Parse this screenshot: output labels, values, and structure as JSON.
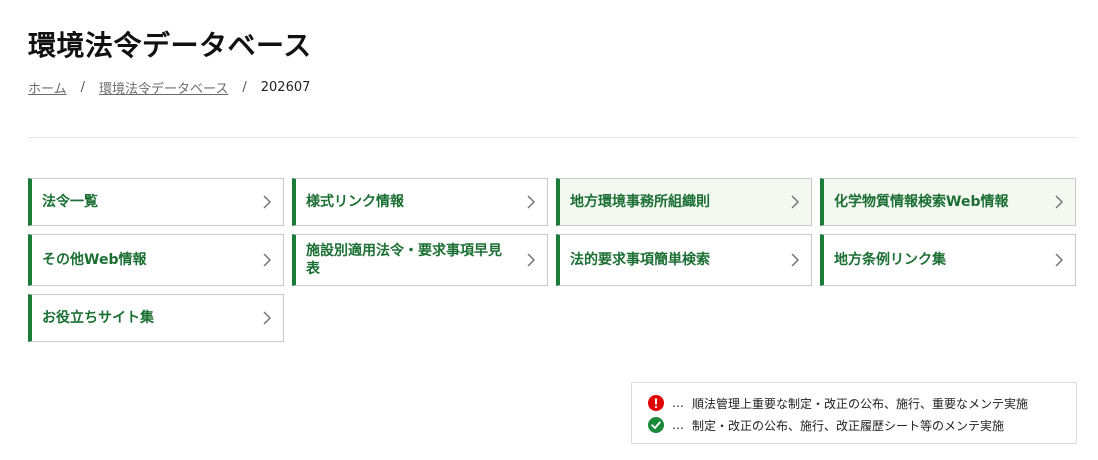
{
  "page": {
    "title": "環境法令データベース"
  },
  "breadcrumb": {
    "home": "ホーム",
    "section": "環境法令データベース",
    "current": "202607",
    "separator": "/"
  },
  "menu": {
    "accent_color": "#1b7d3a",
    "tiles": [
      {
        "label": "法令一覧"
      },
      {
        "label": "様式リンク情報"
      },
      {
        "label": "地方環境事務所組織則"
      },
      {
        "label": "化学物質情報検索Web情報"
      },
      {
        "label": "その他Web情報"
      },
      {
        "label": "施設別適用法令・要求事項早見表"
      },
      {
        "label": "法的要求事項簡単検索"
      },
      {
        "label": "地方条例リンク集"
      },
      {
        "label": "お役立ちサイト集"
      }
    ]
  },
  "legend": {
    "dots": "…",
    "important": {
      "icon": "exclamation-circle-icon",
      "color": "#e00000",
      "text": "順法管理上重要な制定・改正の公布、施行、重要なメンテ実施"
    },
    "normal": {
      "icon": "check-circle-icon",
      "color": "#1b8a3a",
      "text": "制定・改正の公布、施行、改正履歴シート等のメンテ実施"
    }
  }
}
